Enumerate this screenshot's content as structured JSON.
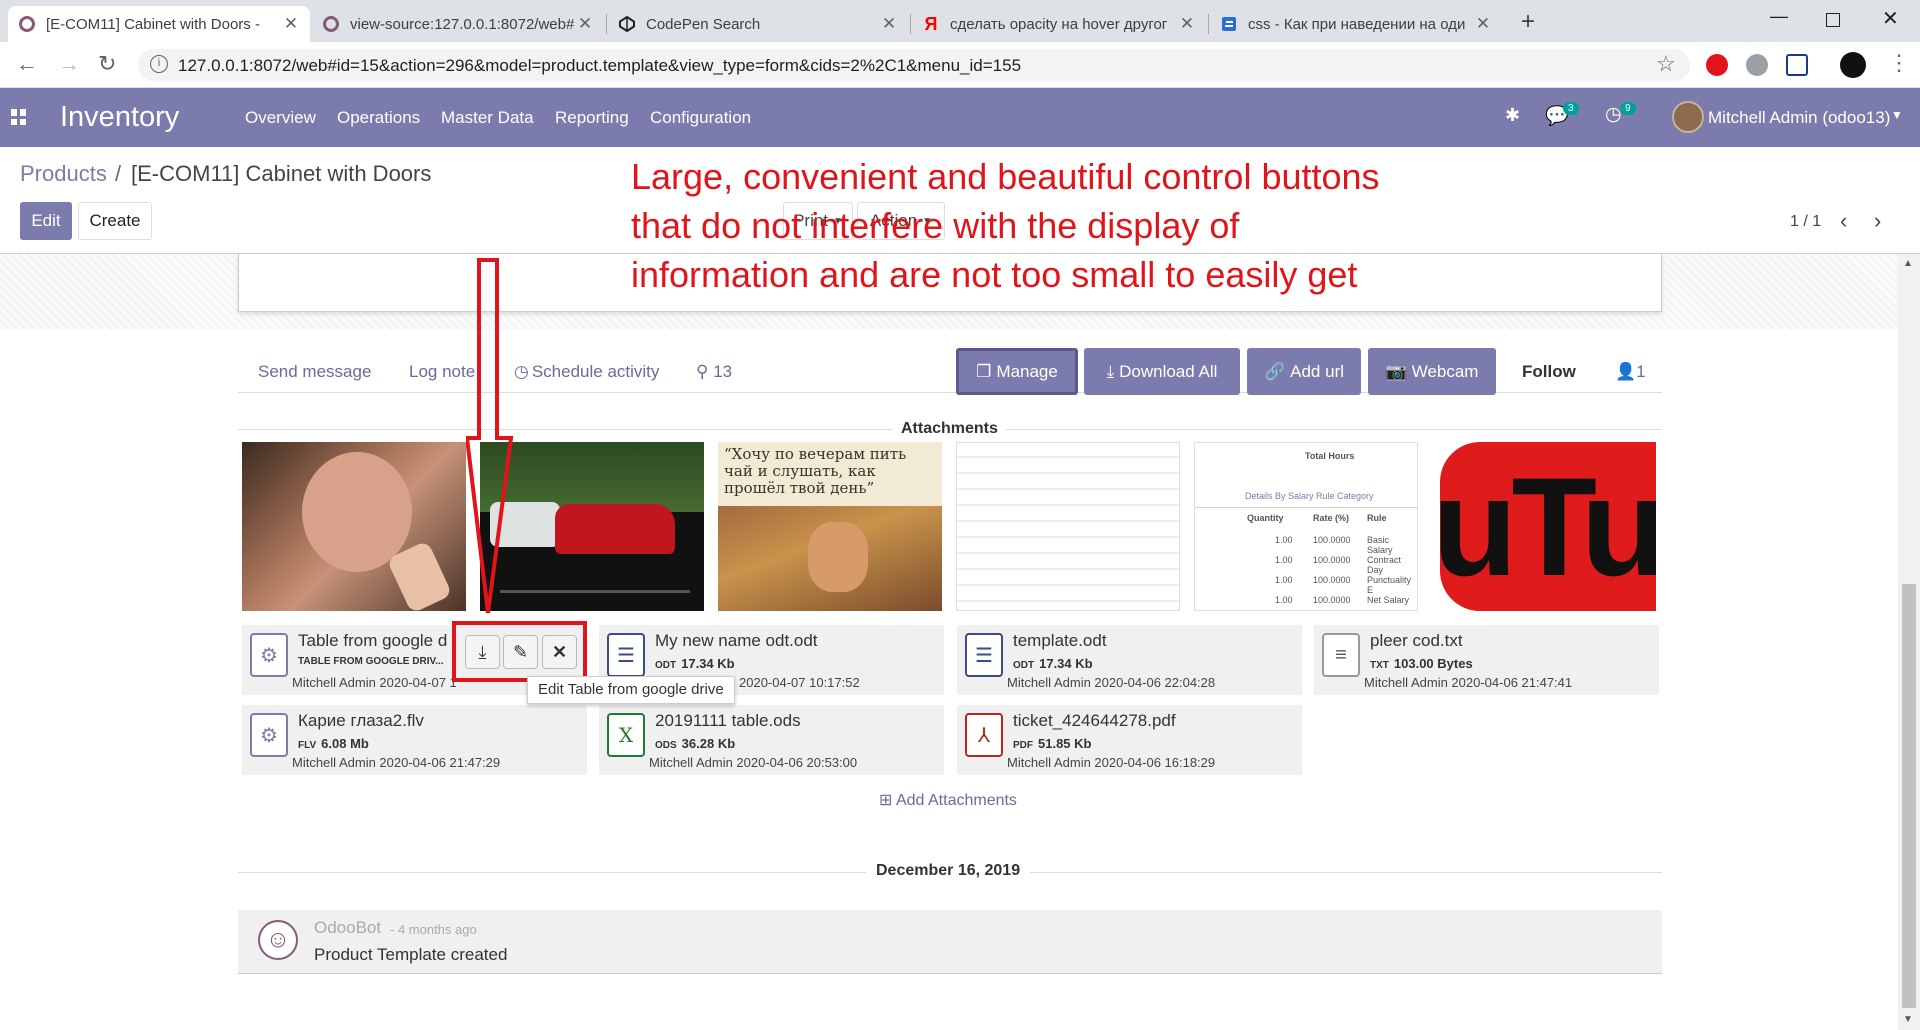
{
  "browser": {
    "tabs": [
      {
        "title": "[E-COM11] Cabinet with Doors -",
        "favicon": "odoo-icon",
        "active": true
      },
      {
        "title": "view-source:127.0.0.1:8072/web#",
        "favicon": "odoo-icon",
        "active": false
      },
      {
        "title": "CodePen Search",
        "favicon": "codepen-icon",
        "active": false
      },
      {
        "title": "сделать opacity на hover другог",
        "favicon": "yandex-icon",
        "active": false
      },
      {
        "title": "css - Как при наведении на оди",
        "favicon": "stackoverflow-icon",
        "active": false
      }
    ],
    "new_tab": "+",
    "url": "127.0.0.1:8072/web#id=15&action=296&model=product.template&view_type=form&cids=2%2C1&menu_id=155"
  },
  "navbar": {
    "app_name": "Inventory",
    "menu": [
      "Overview",
      "Operations",
      "Master Data",
      "Reporting",
      "Configuration"
    ],
    "messages_count": "3",
    "activity_count": "9",
    "user": "Mitchell Admin (odoo13)",
    "accent": "#7c7bad"
  },
  "control_panel": {
    "breadcrumb_parent": "Products",
    "breadcrumb_sep": "/",
    "breadcrumb_current": "[E-COM11] Cabinet with Doors",
    "edit_label": "Edit",
    "create_label": "Create",
    "print_label": "Print",
    "action_label": "Action",
    "pager": "1 / 1"
  },
  "annotation": {
    "line1": "Large, convenient and beautiful control buttons",
    "line2": "that do not interfere with the display of",
    "line3": "information and are not too small to easily get"
  },
  "chatter": {
    "send_message": "Send message",
    "log_note": "Log note",
    "schedule_activity": "Schedule activity",
    "attachment_count": "13",
    "manage": "Manage",
    "download_all": "Download All",
    "add_url": "Add url",
    "webcam": "Webcam",
    "follow": "Follow",
    "followers": "1",
    "attachments_title": "Attachments",
    "add_attachments": "Add Attachments",
    "date_separator": "December 16, 2019",
    "thumbnails": {
      "quote": "“Хочу по вечерам пить чай и слушать, как прошёл твой день”",
      "table_title": "Total Hours",
      "table_tab": "Details By Salary Rule Category",
      "table_cols": [
        "Quantity",
        "Rate (%)",
        "Rule"
      ],
      "table_rows": [
        [
          "1.00",
          "100.0000",
          "Basic Salary"
        ],
        [
          "1.00",
          "100.0000",
          "Contract Day"
        ],
        [
          "1.00",
          "100.0000",
          "Punctuality E"
        ],
        [
          "1.00",
          "100.0000",
          "Net Salary"
        ]
      ],
      "youtube": "uTub"
    },
    "files": [
      {
        "name": "Table from google d...",
        "ext": "",
        "size": "TABLE FROM GOOGLE DRIV...",
        "meta": "Mitchell Admin 2020-04-07 1",
        "icon": "gear-icon"
      },
      {
        "name": "My new name odt.odt",
        "ext": "ODT",
        "size": "17.34 Kb",
        "meta": "2020-04-07 10:17:52",
        "icon": "document-icon"
      },
      {
        "name": "template.odt",
        "ext": "ODT",
        "size": "17.34 Kb",
        "meta": "Mitchell Admin 2020-04-06 22:04:28",
        "icon": "document-icon"
      },
      {
        "name": "pleer cod.txt",
        "ext": "TXT",
        "size": "103.00 Bytes",
        "meta": "Mitchell Admin 2020-04-06 21:47:41",
        "icon": "text-file-icon"
      },
      {
        "name": "Карие глаза2.flv",
        "ext": "FLV",
        "size": "6.08 Mb",
        "meta": "Mitchell Admin 2020-04-06 21:47:29",
        "icon": "gear-icon"
      },
      {
        "name": "20191111 table.ods",
        "ext": "ODS",
        "size": "36.28 Kb",
        "meta": "Mitchell Admin 2020-04-06 20:53:00",
        "icon": "spreadsheet-icon"
      },
      {
        "name": "ticket_424644278.pdf",
        "ext": "PDF",
        "size": "51.85 Kb",
        "meta": "Mitchell Admin 2020-04-06 16:18:29",
        "icon": "pdf-icon"
      }
    ],
    "tooltip": "Edit Table from google drive",
    "message": {
      "author": "OdooBot",
      "time": "- 4 months ago",
      "body": "Product Template created"
    }
  }
}
